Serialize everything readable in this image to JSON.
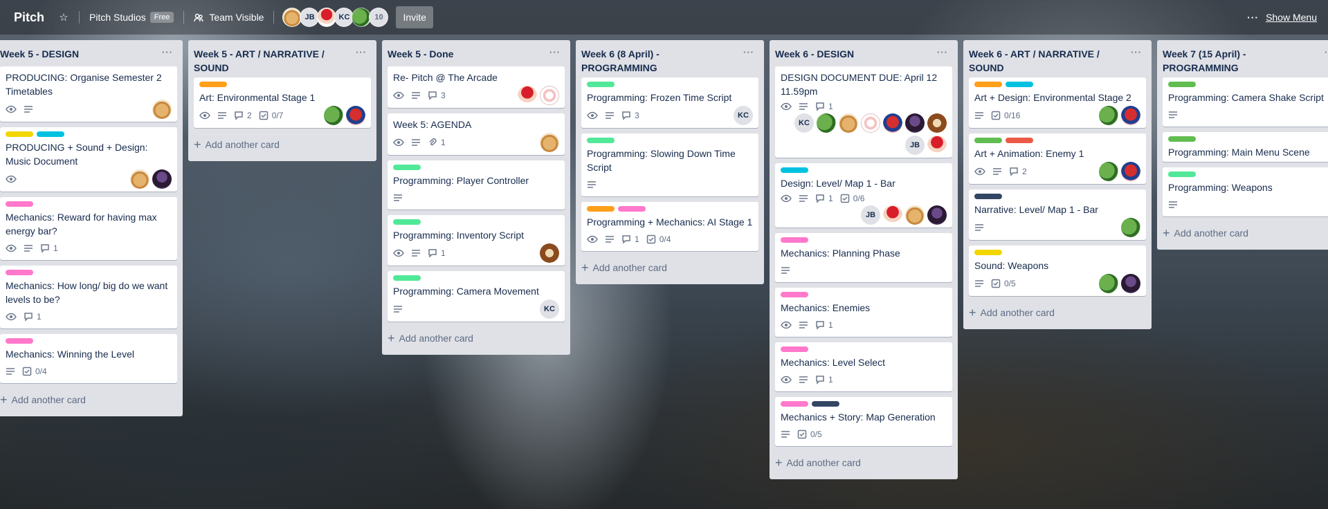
{
  "board": {
    "title": "Pitch",
    "team": "Pitch Studios",
    "team_badge": "Free",
    "visibility": "Team Visible",
    "invite_label": "Invite",
    "show_menu_label": "Show Menu",
    "members": [
      {
        "kind": "photo",
        "style": "dog"
      },
      {
        "kind": "initials",
        "text": "JB"
      },
      {
        "kind": "photo",
        "style": "red"
      },
      {
        "kind": "initials",
        "text": "KC"
      },
      {
        "kind": "photo",
        "style": "frog"
      },
      {
        "kind": "more",
        "text": "10"
      }
    ]
  },
  "colors": {
    "green": "#61bd4f",
    "mint": "#51e898",
    "yellow": "#f2d600",
    "orange": "#ff9f1a",
    "red": "#eb5a46",
    "pink": "#ff78cb",
    "sky": "#00c2e0",
    "black": "#344563"
  },
  "add_card_label": "Add another card",
  "lists": [
    {
      "title": "Week 5 - DESIGN",
      "cards": [
        {
          "labels": [],
          "title": "PRODUCING: Organise Semester 2 Timetables",
          "badges": [
            {
              "icon": "eye"
            },
            {
              "icon": "desc"
            }
          ],
          "avatars": [
            {
              "style": "dog"
            }
          ]
        },
        {
          "labels": [
            "yellow",
            "sky"
          ],
          "title": "PRODUCING + Sound + Design: Music Document",
          "badges": [
            {
              "icon": "eye"
            }
          ],
          "avatars": [
            {
              "style": "dog"
            },
            {
              "style": "purple"
            }
          ]
        },
        {
          "labels": [
            "pink"
          ],
          "title": "Mechanics: Reward for having max energy bar?",
          "badges": [
            {
              "icon": "eye"
            },
            {
              "icon": "desc"
            },
            {
              "icon": "comment",
              "value": "1"
            }
          ],
          "avatars": []
        },
        {
          "labels": [
            "pink"
          ],
          "title": "Mechanics: How long/ big do we want levels to be?",
          "badges": [
            {
              "icon": "eye"
            },
            {
              "icon": "comment",
              "value": "1"
            }
          ],
          "avatars": []
        },
        {
          "labels": [
            "pink"
          ],
          "title": "Mechanics: Winning the Level",
          "badges": [
            {
              "icon": "desc"
            },
            {
              "icon": "check",
              "value": "0/4"
            }
          ],
          "avatars": []
        }
      ]
    },
    {
      "title": "Week 5 - ART / NARRATIVE / SOUND",
      "cards": [
        {
          "labels": [
            "orange"
          ],
          "title": "Art: Environmental Stage 1",
          "badges": [
            {
              "icon": "eye"
            },
            {
              "icon": "desc"
            },
            {
              "icon": "comment",
              "value": "2"
            },
            {
              "icon": "check",
              "value": "0/7"
            }
          ],
          "avatars": [
            {
              "style": "frog"
            },
            {
              "style": "spider"
            }
          ]
        }
      ]
    },
    {
      "title": "Week 5 - Done",
      "cards": [
        {
          "labels": [],
          "title": "Re- Pitch @ The Arcade",
          "badges": [
            {
              "icon": "eye"
            },
            {
              "icon": "desc"
            },
            {
              "icon": "comment",
              "value": "3"
            }
          ],
          "avatars": [
            {
              "style": "red"
            },
            {
              "style": "cat"
            }
          ]
        },
        {
          "labels": [],
          "title": "Week 5: AGENDA",
          "badges": [
            {
              "icon": "eye"
            },
            {
              "icon": "desc"
            },
            {
              "icon": "attach",
              "value": "1"
            }
          ],
          "avatars": [
            {
              "style": "dog"
            }
          ]
        },
        {
          "labels": [
            "mint"
          ],
          "title": "Programming: Player Controller",
          "badges": [
            {
              "icon": "desc"
            }
          ],
          "avatars": []
        },
        {
          "labels": [
            "mint"
          ],
          "title": "Programming: Inventory Script",
          "badges": [
            {
              "icon": "eye"
            },
            {
              "icon": "desc"
            },
            {
              "icon": "comment",
              "value": "1"
            }
          ],
          "avatars": [
            {
              "style": "brown"
            }
          ]
        },
        {
          "labels": [
            "mint"
          ],
          "title": "Programming: Camera Movement",
          "badges": [
            {
              "icon": "desc"
            }
          ],
          "avatars": [
            {
              "style": "initials",
              "text": "KC"
            }
          ]
        }
      ]
    },
    {
      "title": "Week 6 (8 April) - PROGRAMMING",
      "cards": [
        {
          "labels": [
            "mint"
          ],
          "title": "Programming: Frozen Time Script",
          "badges": [
            {
              "icon": "eye"
            },
            {
              "icon": "desc"
            },
            {
              "icon": "comment",
              "value": "3"
            }
          ],
          "avatars": [
            {
              "style": "initials",
              "text": "KC"
            }
          ]
        },
        {
          "labels": [
            "mint"
          ],
          "title": "Programming: Slowing Down Time Script",
          "badges": [
            {
              "icon": "desc"
            }
          ],
          "avatars": []
        },
        {
          "labels": [
            "orange",
            "pink"
          ],
          "title": "Programming + Mechanics: AI Stage 1",
          "badges": [
            {
              "icon": "eye"
            },
            {
              "icon": "desc"
            },
            {
              "icon": "comment",
              "value": "1"
            },
            {
              "icon": "check",
              "value": "0/4"
            }
          ],
          "avatars": []
        }
      ]
    },
    {
      "title": "Week 6 - DESIGN",
      "cards": [
        {
          "labels": [],
          "title": "DESIGN DOCUMENT DUE: April 12 11.59pm",
          "badges": [
            {
              "icon": "eye"
            },
            {
              "icon": "desc"
            },
            {
              "icon": "comment",
              "value": "1"
            }
          ],
          "avatars": [
            {
              "style": "initials",
              "text": "KC"
            },
            {
              "style": "frog"
            },
            {
              "style": "dog"
            },
            {
              "style": "cat"
            },
            {
              "style": "spider"
            },
            {
              "style": "purple"
            },
            {
              "style": "brown"
            },
            {
              "style": "initials",
              "text": "JB"
            },
            {
              "style": "red"
            }
          ]
        },
        {
          "labels": [
            "sky"
          ],
          "title": "Design: Level/ Map 1 - Bar",
          "badges": [
            {
              "icon": "eye"
            },
            {
              "icon": "desc"
            },
            {
              "icon": "comment",
              "value": "1"
            },
            {
              "icon": "check",
              "value": "0/6"
            }
          ],
          "avatars": [
            {
              "style": "initials",
              "text": "JB"
            },
            {
              "style": "red"
            },
            {
              "style": "dog"
            },
            {
              "style": "purple"
            }
          ]
        },
        {
          "labels": [
            "pink"
          ],
          "title": "Mechanics: Planning Phase",
          "badges": [
            {
              "icon": "desc"
            }
          ],
          "avatars": []
        },
        {
          "labels": [
            "pink"
          ],
          "title": "Mechanics: Enemies",
          "badges": [
            {
              "icon": "eye"
            },
            {
              "icon": "desc"
            },
            {
              "icon": "comment",
              "value": "1"
            }
          ],
          "avatars": []
        },
        {
          "labels": [
            "pink"
          ],
          "title": "Mechanics: Level Select",
          "badges": [
            {
              "icon": "eye"
            },
            {
              "icon": "desc"
            },
            {
              "icon": "comment",
              "value": "1"
            }
          ],
          "avatars": []
        },
        {
          "labels": [
            "pink",
            "black"
          ],
          "title": "Mechanics + Story: Map Generation",
          "badges": [
            {
              "icon": "desc"
            },
            {
              "icon": "check",
              "value": "0/5"
            }
          ],
          "avatars": []
        }
      ]
    },
    {
      "title": "Week 6 - ART / NARRATIVE / SOUND",
      "cards": [
        {
          "labels": [
            "orange",
            "sky"
          ],
          "title": "Art + Design: Environmental Stage 2",
          "badges": [
            {
              "icon": "desc"
            },
            {
              "icon": "check",
              "value": "0/16"
            }
          ],
          "avatars": [
            {
              "style": "frog"
            },
            {
              "style": "spider"
            }
          ]
        },
        {
          "labels": [
            "green",
            "red"
          ],
          "title": "Art + Animation: Enemy 1",
          "badges": [
            {
              "icon": "eye"
            },
            {
              "icon": "desc"
            },
            {
              "icon": "comment",
              "value": "2"
            }
          ],
          "avatars": [
            {
              "style": "frog"
            },
            {
              "style": "spider"
            }
          ]
        },
        {
          "labels": [
            "black"
          ],
          "title": "Narrative: Level/ Map 1 - Bar",
          "badges": [
            {
              "icon": "desc"
            }
          ],
          "avatars": [
            {
              "style": "frog"
            }
          ]
        },
        {
          "labels": [
            "yellow"
          ],
          "title": "Sound: Weapons",
          "badges": [
            {
              "icon": "desc"
            },
            {
              "icon": "check",
              "value": "0/5"
            }
          ],
          "avatars": [
            {
              "style": "frog"
            },
            {
              "style": "purple"
            }
          ]
        }
      ]
    },
    {
      "title": "Week 7 (15 April) - PROGRAMMING",
      "cards": [
        {
          "labels": [
            "green"
          ],
          "title": "Programming: Camera Shake Script",
          "badges": [
            {
              "icon": "desc"
            }
          ],
          "avatars": []
        },
        {
          "labels": [
            "green"
          ],
          "title": "Programming: Main Menu Scene",
          "badges": [],
          "avatars": []
        },
        {
          "labels": [
            "mint"
          ],
          "title": "Programming: Weapons",
          "badges": [
            {
              "icon": "desc"
            }
          ],
          "avatars": []
        }
      ]
    }
  ]
}
